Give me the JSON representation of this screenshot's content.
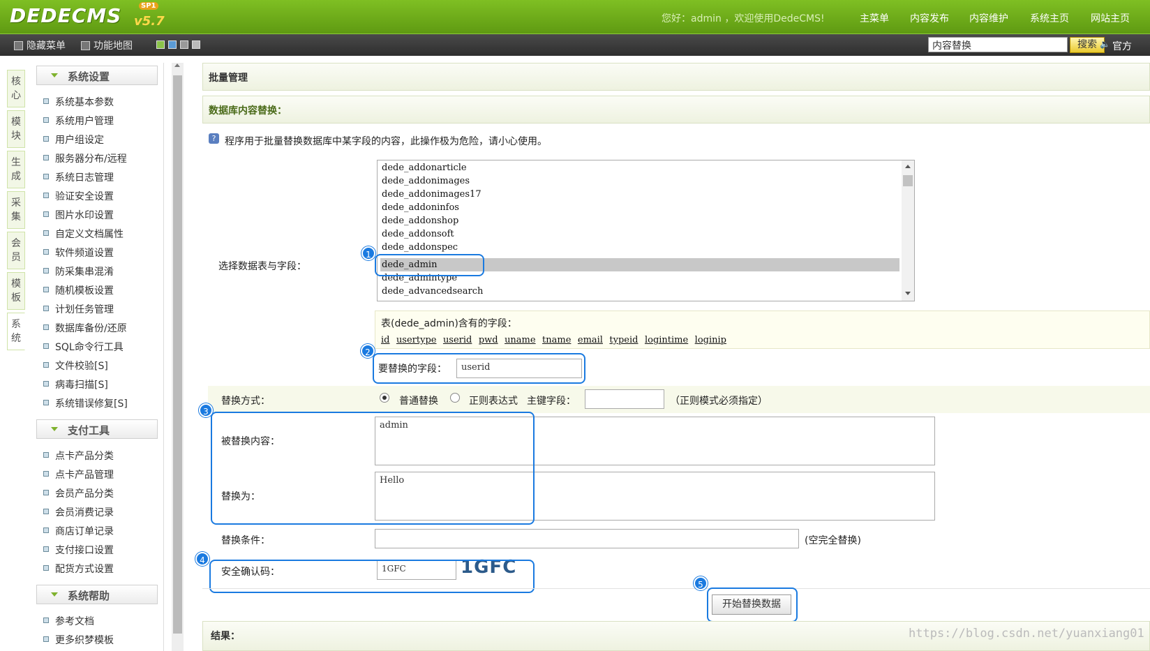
{
  "brand": {
    "logo": "DEDECMS",
    "version": "v5.7",
    "sp": "SP1"
  },
  "header": {
    "greeting": "您好：admin ，欢迎使用DedeCMS!",
    "nav": [
      "主菜单",
      "内容发布",
      "内容维护",
      "系统主页",
      "网站主页"
    ]
  },
  "subbar": {
    "hide_menu": "隐藏菜单",
    "func_map": "功能地图",
    "search_value": "内容替换",
    "search_button": "搜索",
    "official": "官方"
  },
  "left_tabs": [
    "核心",
    "模块",
    "生成",
    "采集",
    "会员",
    "模板",
    "系统"
  ],
  "menu": {
    "sys_settings": {
      "title": "系统设置",
      "items": [
        "系统基本参数",
        "系统用户管理",
        "用户组设定",
        "服务器分布/远程",
        "系统日志管理",
        "验证安全设置",
        "图片水印设置",
        "自定义文档属性",
        "软件频道设置",
        "防采集串混淆",
        "随机模板设置",
        "计划任务管理",
        "数据库备份/还原",
        "SQL命令行工具",
        "文件校验[S]",
        "病毒扫描[S]",
        "系统错误修复[S]"
      ]
    },
    "pay_tools": {
      "title": "支付工具",
      "items": [
        "点卡产品分类",
        "点卡产品管理",
        "会员产品分类",
        "会员消费记录",
        "商店订单记录",
        "支付接口设置",
        "配货方式设置"
      ]
    },
    "sys_help": {
      "title": "系统帮助",
      "items": [
        "参考文档",
        "更多织梦模板"
      ]
    }
  },
  "main": {
    "title": "批量管理",
    "section": "数据库内容替换：",
    "warning": "程序用于批量替换数据库中某字段的内容，此操作极为危险，请小心使用。",
    "select_label": "选择数据表与字段：",
    "tables": [
      "dede_addonarticle",
      "dede_addonimages",
      "dede_addonimages17",
      "dede_addoninfos",
      "dede_addonshop",
      "dede_addonsoft",
      "dede_addonspec",
      "dede_admin",
      "dede_admintype",
      "dede_advancedsearch"
    ],
    "selected_table": "dede_admin",
    "fields_caption": "表(dede_admin)含有的字段：",
    "fields": [
      "id",
      "usertype",
      "userid",
      "pwd",
      "uname",
      "tname",
      "email",
      "typeid",
      "logintime",
      "loginip"
    ],
    "replace_field_label": "要替换的字段：",
    "replace_field_value": "userid",
    "mode_label": "替换方式：",
    "mode_normal": "普通替换",
    "mode_regex": "正则表达式",
    "key_field_label": "主键字段：",
    "regex_note": "（正则模式必须指定）",
    "from_label": "被替换内容：",
    "from_value": "admin",
    "to_label": "替换为：",
    "to_value": "Hello",
    "cond_label": "替换条件：",
    "cond_note": "(空完全替换)",
    "captcha_label": "安全确认码：",
    "captcha_value": "1GFC",
    "captcha_image_text": "1GFC",
    "submit": "开始替换数据",
    "result_label": "结果：",
    "markers": [
      "1",
      "2",
      "3",
      "4",
      "5"
    ]
  },
  "watermark": "https://blog.csdn.net/yuanxiang01"
}
